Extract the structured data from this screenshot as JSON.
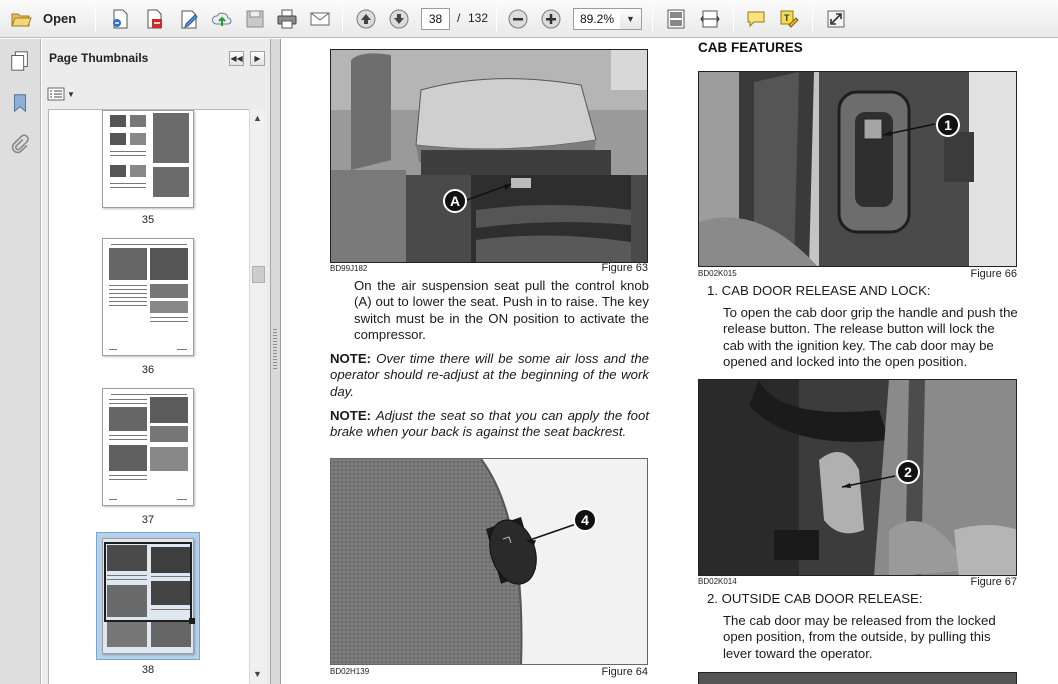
{
  "toolbar": {
    "open_label": "Open",
    "page_current": "38",
    "page_separator": "/",
    "page_total": "132",
    "zoom": "89.2%",
    "icons": [
      "open-folder-icon",
      "create-pdf-icon",
      "export-pdf-icon",
      "edit-icon",
      "upload-icon",
      "save-icon",
      "print-icon",
      "email-icon",
      "page-up-icon",
      "page-down-icon",
      "zoom-out-icon",
      "zoom-in-icon",
      "fit-page-icon",
      "fit-width-icon",
      "comment-icon",
      "highlight-icon",
      "expand-icon"
    ]
  },
  "thumbnails": {
    "title": "Page Thumbnails",
    "pages": [
      "35",
      "36",
      "37",
      "38"
    ],
    "selected": "38"
  },
  "document": {
    "fig63": {
      "code": "BD99J182",
      "label": "Figure 63",
      "callout": "A"
    },
    "para1": "On the air suspension seat pull the control knob (A) out to lower the seat. Push in to raise. The key switch must be in the ON position to activate the compressor.",
    "note1": {
      "label": "NOTE:",
      "text": "Over time there will be some air loss and the operator should re-adjust at the beginning of the work day."
    },
    "note2": {
      "label": "NOTE:",
      "text": "Adjust the seat so that you can apply the foot brake when your back is against the seat backrest."
    },
    "fig64": {
      "code": "BD02H139",
      "label": "Figure 64",
      "callout": "4"
    },
    "heading": "CAB FEATURES",
    "fig66": {
      "code": "BD02K015",
      "label": "Figure 66",
      "callout": "1"
    },
    "item1_title": "1. CAB DOOR RELEASE AND LOCK:",
    "item1_text": "To open the cab door grip the handle and push the release button. The release button will lock the cab with the ignition key. The cab door may be opened and locked into the open position.",
    "fig67": {
      "code": "BD02K014",
      "label": "Figure 67",
      "callout": "2"
    },
    "item2_title": "2. OUTSIDE CAB DOOR RELEASE:",
    "item2_text": "The cab door may be released from the locked open position, from the outside, by pulling this lever toward the operator."
  }
}
